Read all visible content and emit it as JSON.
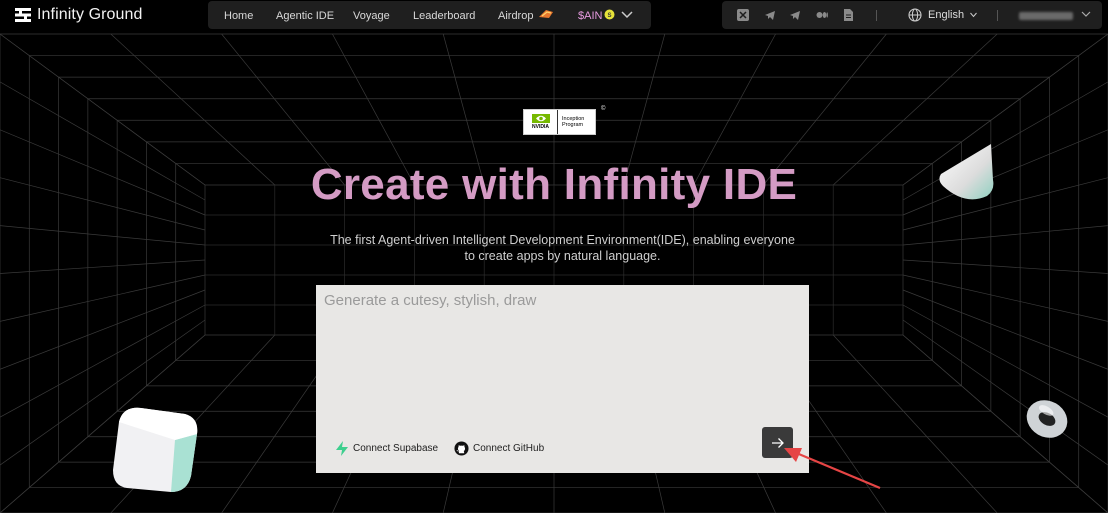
{
  "header": {
    "brand": "Infinity Ground",
    "nav": [
      {
        "label": "Home"
      },
      {
        "label": "Agentic IDE"
      },
      {
        "label": "Voyage"
      },
      {
        "label": "Leaderboard"
      },
      {
        "label": "Airdrop"
      },
      {
        "label": "$AIN"
      }
    ],
    "social_icons": [
      "x-icon",
      "telegram-icon",
      "telegram-icon",
      "medium-icon",
      "document-icon"
    ],
    "language": "English"
  },
  "hero": {
    "badge_text_line1": "Inception",
    "badge_text_line2": "Program",
    "badge_logo_word": "NVIDIA",
    "badge_registered": "©",
    "title": "Create with Infinity IDE",
    "subtitle_line1": "The first Agent-driven Intelligent Development Environment(IDE), enabling everyone",
    "subtitle_line2": "to create apps by natural language."
  },
  "prompt": {
    "placeholder": "Generate a cutesy, stylish, draw",
    "value": "",
    "connect_supabase": "Connect Supabase",
    "connect_github": "Connect GitHub"
  },
  "colors": {
    "accent_title": "#d49bc4",
    "ain": "#e79be0",
    "supabase": "#3ecf8e",
    "annotation_arrow": "#e64545"
  }
}
